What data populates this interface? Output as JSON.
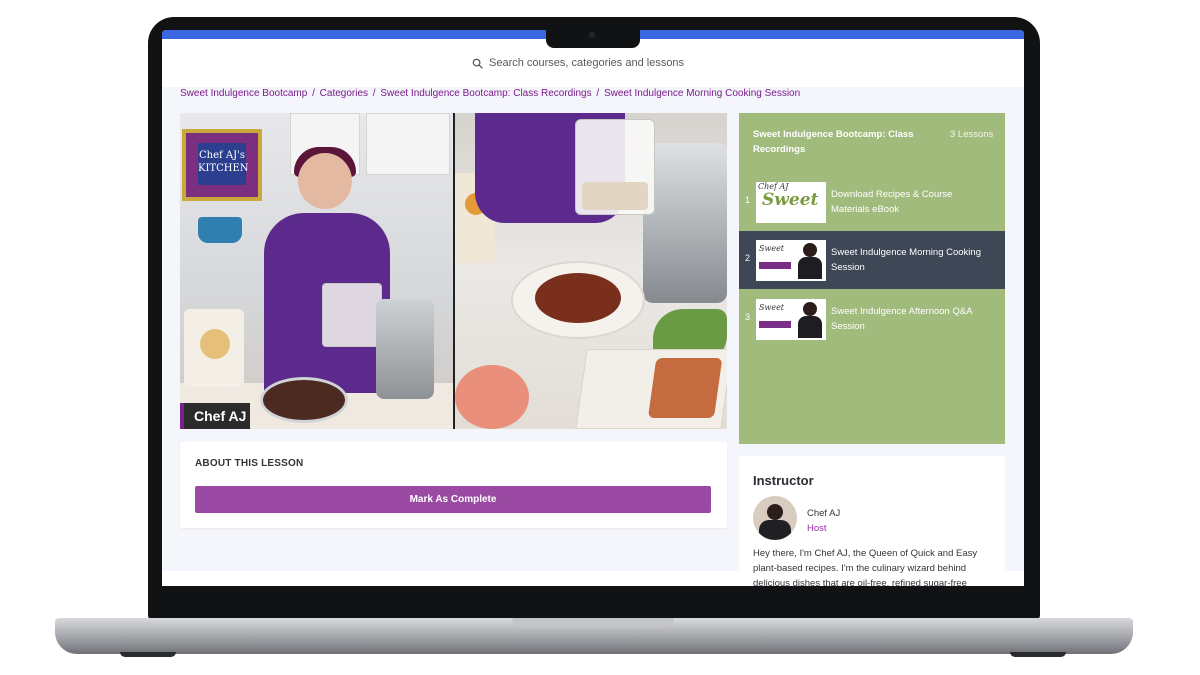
{
  "header": {
    "search_placeholder": "Search courses, categories and lessons"
  },
  "breadcrumb": {
    "items": [
      "Sweet Indulgence Bootcamp",
      "Categories",
      "Sweet Indulgence Bootcamp: Class Recordings",
      "Sweet Indulgence Morning Cooking Session"
    ],
    "separator": "/"
  },
  "video": {
    "overlay_label": "Chef AJ",
    "sign_text": "Chef AJ's KITCHEN"
  },
  "about": {
    "title": "ABOUT THIS LESSON",
    "button_label": "Mark As Complete"
  },
  "lessons": {
    "course_title": "Sweet Indulgence Bootcamp: Class Recordings",
    "count_label": "3 Lessons",
    "items": [
      {
        "number": "1",
        "title": "Download Recipes & Course Materials eBook",
        "active": false,
        "thumb_text": "Sweet",
        "thumb_brand": "Chef AJ"
      },
      {
        "number": "2",
        "title": "Sweet Indulgence Morning Cooking Session",
        "active": true,
        "thumb_text": "Sweet"
      },
      {
        "number": "3",
        "title": "Sweet Indulgence Afternoon Q&A Session",
        "active": false,
        "thumb_text": "Sweet"
      }
    ]
  },
  "instructor": {
    "heading": "Instructor",
    "name": "Chef AJ",
    "role": "Host",
    "bio": "Hey there, I'm Chef AJ, the Queen of Quick and Easy plant-based recipes. I'm the culinary wizard behind delicious dishes that are oil-free, refined sugar-free"
  },
  "colors": {
    "top_bar": "#3a66e0",
    "breadcrumb": "#7b1a8c",
    "button": "#9b4aa4",
    "lessons_bg": "#a1bb7d",
    "lesson_active": "#3e4756",
    "host_role": "#9b2aa7"
  },
  "icons": {
    "search": "search-icon"
  }
}
